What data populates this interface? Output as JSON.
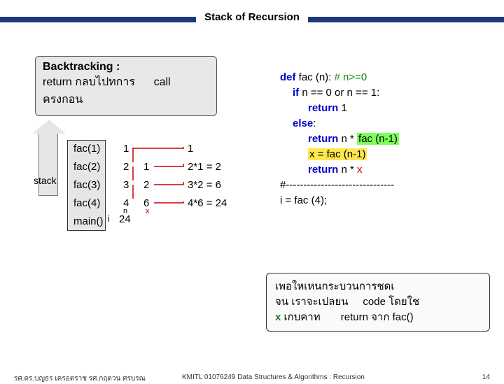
{
  "title": "Stack of Recursion",
  "callout": {
    "heading": "Backtracking :",
    "line1a": "return ",
    "line1b": "กลบไปทการ",
    "line1c": "call",
    "line2": "ครงกอน"
  },
  "stack": {
    "label": "stack",
    "calls": [
      "fac(1)",
      "fac(2)",
      "fac(3)",
      "fac(4)",
      "main()"
    ],
    "n_vals": [
      "1",
      "2",
      "3",
      "4"
    ],
    "x_vals": [
      "1",
      "2",
      "6"
    ],
    "results": [
      "1",
      "2*1 = 2",
      "3*2 = 6",
      "4*6 = 24"
    ],
    "i_label": "i",
    "i_val": "24",
    "n_label": "n",
    "x_label": "x"
  },
  "code": {
    "l1a": "def",
    "l1b": " fac (n): ",
    "l1c": "# n>=0",
    "l2a": "if",
    "l2b": " n == 0 or n == 1:",
    "l3a": "return",
    "l3b": " 1",
    "l4a": "else",
    "l4b": ":",
    "l5a": "return",
    "l5b": "   n * ",
    "l5c": "fac (n-1)",
    "l6": "x = fac (n-1)",
    "l7a": "return",
    "l7b": "   n * ",
    "l7c": "x",
    "dashes": "#-------------------------------",
    "l8": "i  =  fac (4);"
  },
  "note": {
    "l1": "เพอใหเหนกระบวนการชดเ",
    "l2a": "จน เราจะเปลยน",
    "l2b": "code โดยใช",
    "l3a": "x",
    "l3b": " เกบคาท",
    "l3c": "return จาก fac()"
  },
  "footer": {
    "left": "รศ.ดร.บญธร   เครอตราช    รศ.กฤตวน ศรบรณ",
    "center": "KMITL   01076249 Data Structures & Algorithms : Recursion",
    "page": "14"
  }
}
